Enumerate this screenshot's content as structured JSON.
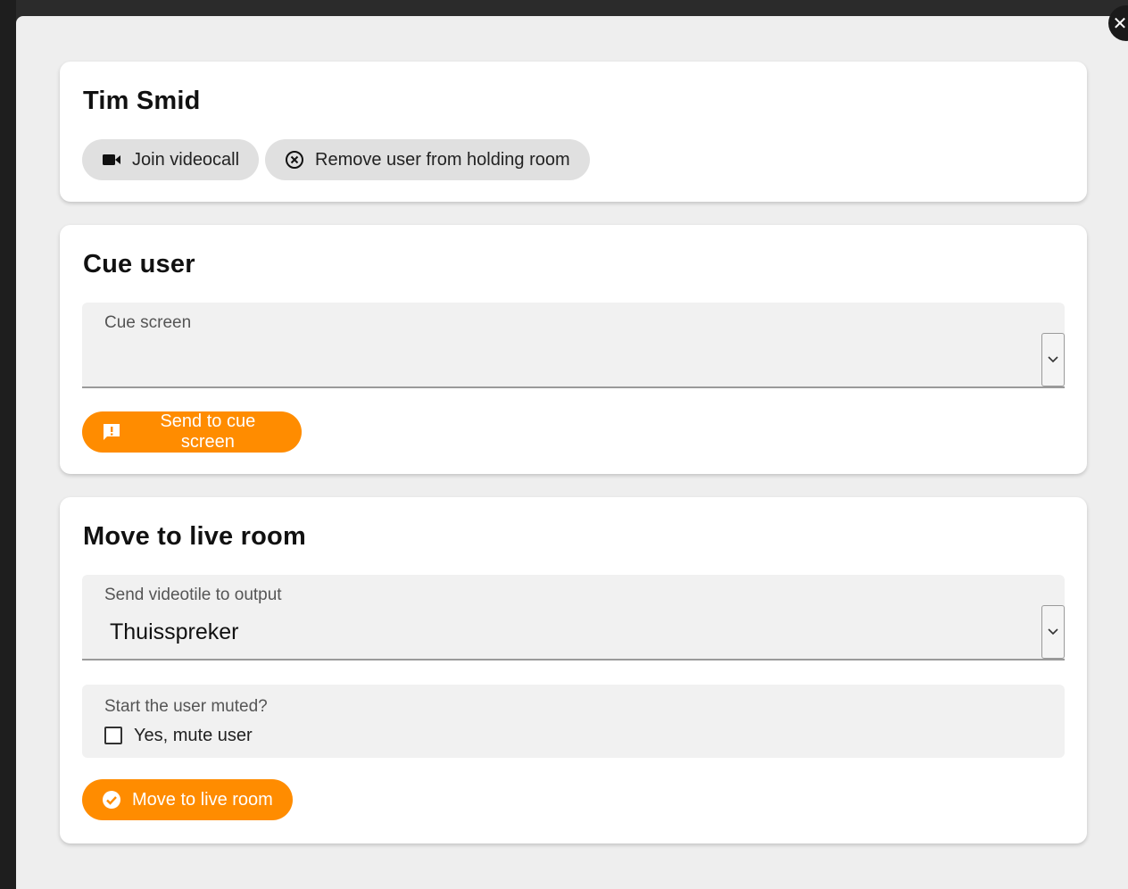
{
  "user_card": {
    "name": "Tim Smid",
    "join_button": "Join videocall",
    "remove_button": "Remove user from holding room"
  },
  "cue_card": {
    "title": "Cue user",
    "cue_screen_label": "Cue screen",
    "cue_screen_value": "",
    "send_button": "Send to cue screen"
  },
  "live_card": {
    "title": "Move to live room",
    "output_label": "Send videotile to output",
    "output_value": "Thuisspreker",
    "mute_question": "Start the user muted?",
    "mute_checkbox_label": "Yes, mute user",
    "mute_checked": false,
    "move_button": "Move to live room"
  },
  "colors": {
    "accent": "#ff8c00",
    "modal_bg": "#eeeeee",
    "card_bg": "#ffffff",
    "grey_button": "#e0e0e0"
  },
  "icons": {
    "close": "close-icon",
    "video": "video-camera-icon",
    "remove": "circle-x-icon",
    "message": "message-alert-icon",
    "check": "check-circle-icon",
    "dropdown": "chevron-down-icon"
  }
}
